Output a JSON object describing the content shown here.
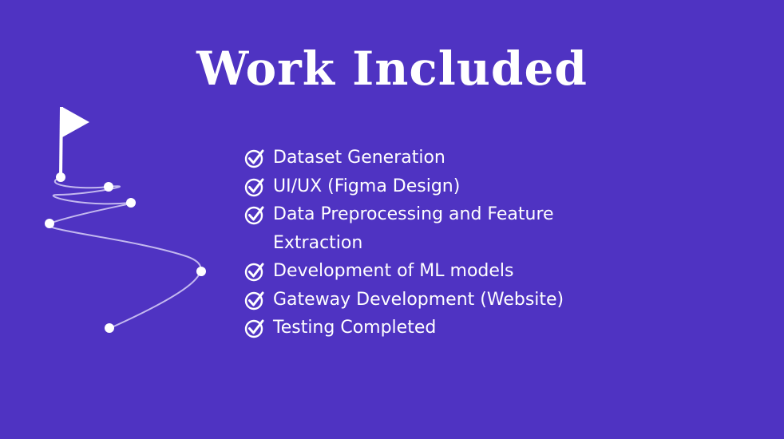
{
  "slide": {
    "title": "Work Included",
    "background_color": "#4f33c2",
    "text_color": "#ffffff",
    "icons": {
      "roadmap": "winding-road-with-flag-icon",
      "bullet": "check-circle-icon"
    },
    "items": [
      "Dataset Generation",
      "UI/UX (Figma Design)",
      "Data Preprocessing and Feature Extraction",
      "Development of ML models",
      "Gateway Development (Website)",
      "Testing Completed"
    ]
  }
}
